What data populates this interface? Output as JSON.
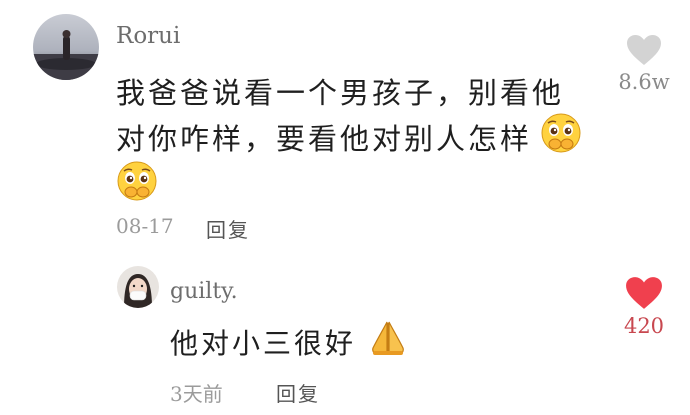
{
  "main_comment": {
    "username": "Rorui",
    "line1": "我爸爸说看一个男孩子，别看他",
    "line2": "对你咋样，要看他对别人怎样",
    "date": "08-17",
    "reply_label": "回复",
    "like_count": "8.6w",
    "liked": false,
    "emoji_name": "pleading-face-hands-emoji"
  },
  "reply_comment": {
    "username": "guilty.",
    "text": "他对小三很好",
    "date": "3天前",
    "reply_label": "回复",
    "like_count": "420",
    "liked": true,
    "emoji_name": "folded-hands-emoji"
  },
  "colors": {
    "liked": "#f0404e",
    "unliked": "#d0d0d0",
    "meta": "#9b9b9b"
  }
}
